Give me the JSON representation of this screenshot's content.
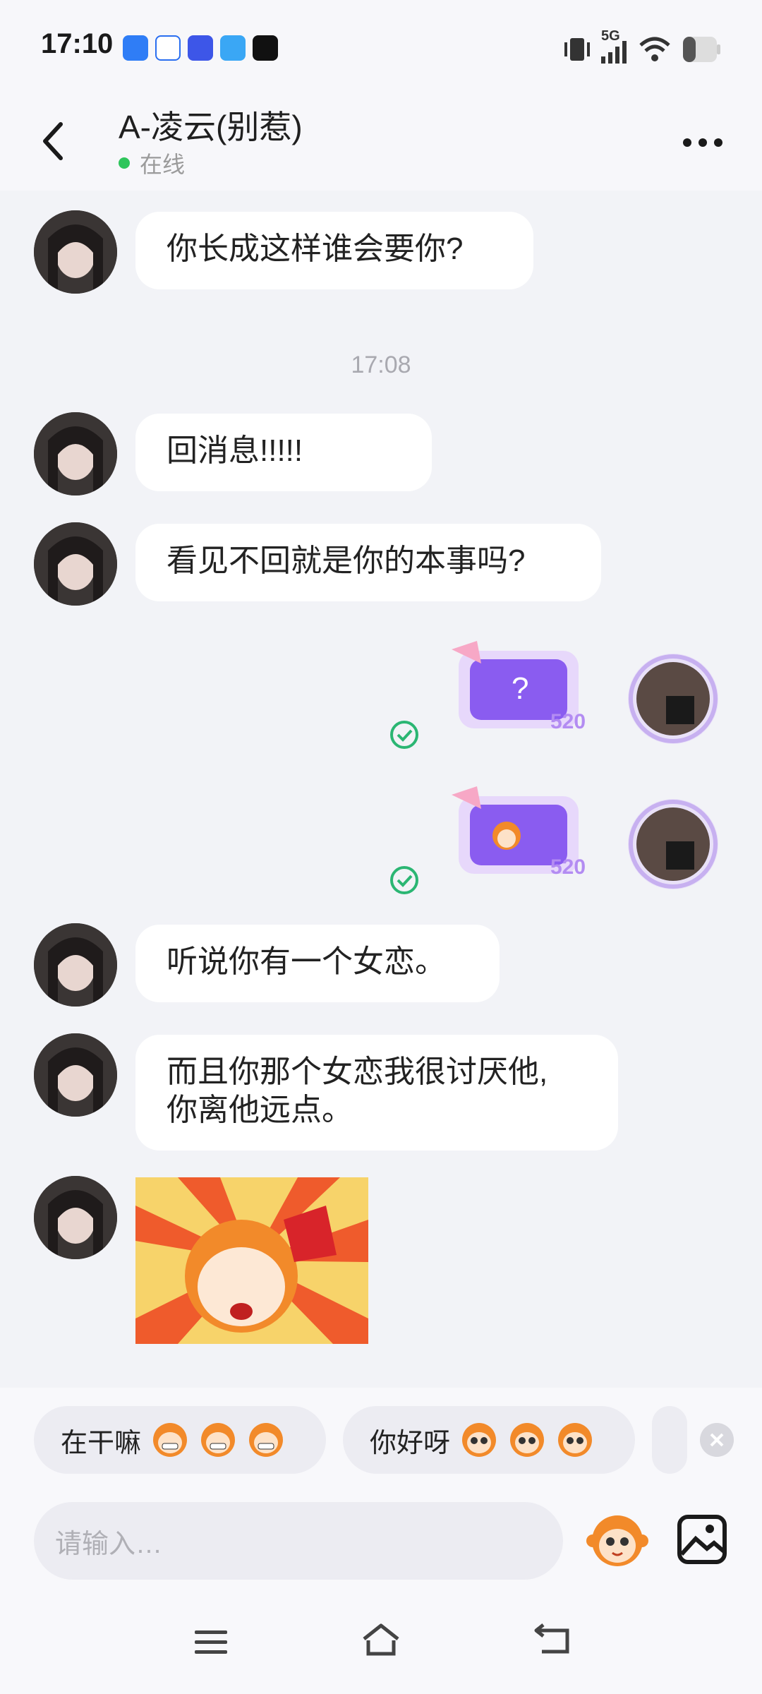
{
  "status_bar": {
    "time": "17:10",
    "network": "5G"
  },
  "header": {
    "title": "A-凌云(别惹)",
    "status": "在线"
  },
  "messages": [
    {
      "side": "left",
      "type": "text",
      "text": "你长成这样谁会要你?"
    },
    {
      "side": "center",
      "type": "time",
      "text": "17:08"
    },
    {
      "side": "left",
      "type": "text",
      "text": "回消息!!!!!"
    },
    {
      "side": "left",
      "type": "text",
      "text": "看见不回就是你的本事吗?"
    },
    {
      "side": "right",
      "type": "gift",
      "content": "?",
      "badge": "520"
    },
    {
      "side": "right",
      "type": "gift",
      "content": "sticker",
      "badge": "520"
    },
    {
      "side": "left",
      "type": "text",
      "text": "听说你有一个女恋。"
    },
    {
      "side": "left",
      "type": "text",
      "text": "而且你那个女恋我很讨厌他,\n你离他远点。"
    },
    {
      "side": "left",
      "type": "sticker",
      "content": "angry-monkey-sticker"
    }
  ],
  "quick_replies": [
    {
      "text": "在干嘛"
    },
    {
      "text": "你好呀"
    }
  ],
  "input": {
    "placeholder": "请输入…"
  },
  "colors": {
    "bubble": "#ffffff",
    "bg": "#f2f3f7",
    "online": "#2ec55b",
    "check": "#2bb673",
    "gift": "#8a5cf0"
  }
}
